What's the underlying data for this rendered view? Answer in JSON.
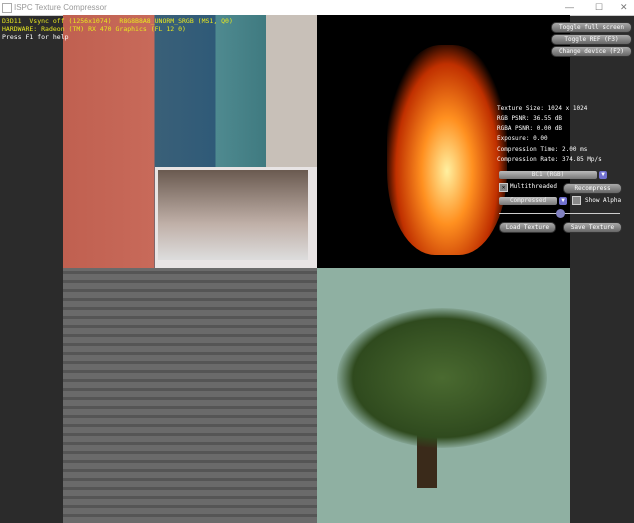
{
  "window": {
    "title": "ISPC Texture Compressor",
    "minimize": "—",
    "maximize": "☐",
    "close": "✕"
  },
  "hud": {
    "line1": "D3D11  Vsync off (1256x1074)  R8G8B8A8_UNORM_SRGB (MS1, Q0)",
    "line2": "HARDWARE: Radeon (TM) RX 470 Graphics (FL 12 0)",
    "line3": "Press F1 for help"
  },
  "buttons": {
    "fullscreen": "Toggle full screen",
    "ref": "Toggle REF (F3)",
    "device": "Change device (F2)",
    "recompress": "Recompress",
    "load": "Load Texture",
    "save": "Save Texture"
  },
  "stats": {
    "size": "Texture Size: 1024 x 1024",
    "rgb_psnr": "RGB PSNR: 36.55 dB",
    "rgba_psnr": "RGBA PSNR: 0.00 dB",
    "exposure": "Exposure: 0.00",
    "time": "Compression Time: 2.00 ms",
    "rate": "Compression Rate: 374.85 Mp/s"
  },
  "controls": {
    "format": "BC1 (RGB)",
    "multithreaded_label": "Multithreaded",
    "multithreaded": true,
    "view": "Compressed",
    "show_alpha_label": "Show Alpha",
    "show_alpha": false,
    "exposure_slider": 0.5
  }
}
